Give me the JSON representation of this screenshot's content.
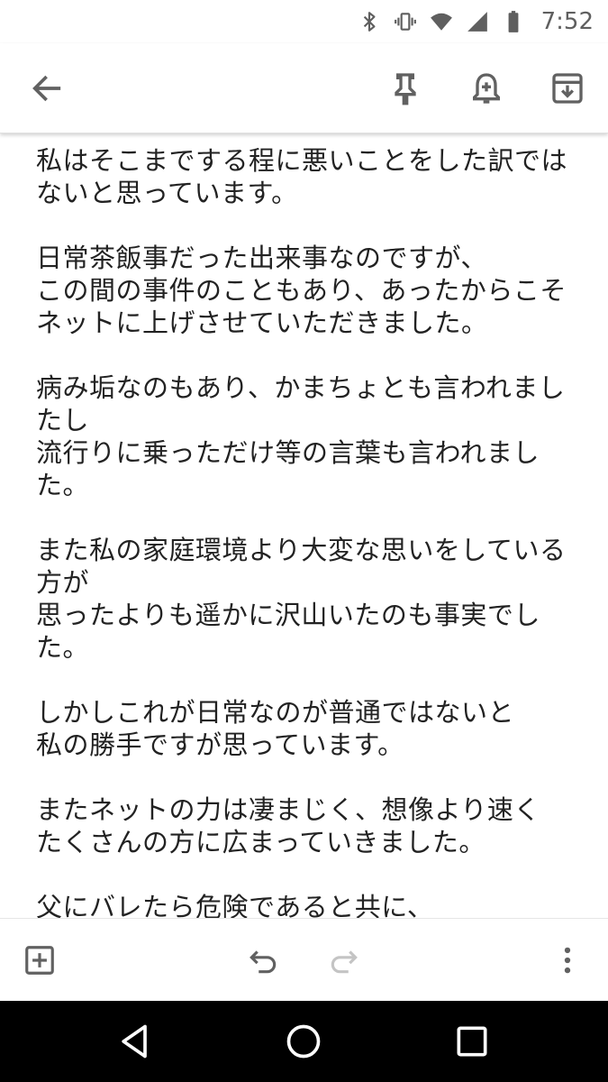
{
  "status_bar": {
    "time": "7:52",
    "icons": [
      "bluetooth-icon",
      "vibrate-icon",
      "wifi-icon",
      "cell-signal-icon",
      "battery-icon"
    ]
  },
  "toolbar": {
    "back_icon": "arrow-back-icon",
    "pin_icon": "pin-icon",
    "reminder_icon": "add-alert-icon",
    "archive_icon": "archive-icon"
  },
  "note": {
    "lines": [
      "私はそこまでする程に悪いことをした訳では",
      "ないと思っています。",
      "",
      "日常茶飯事だった出来事なのですが、",
      "この間の事件のこともあり、あったからこそ",
      "ネットに上げさせていただきました。",
      "",
      "病み垢なのもあり、かまちょとも言われまし",
      "たし",
      "流行りに乗っただけ等の言葉も言われまし",
      "た。",
      "",
      "また私の家庭環境より大変な思いをしている",
      "方が",
      "思ったよりも遥かに沢山いたのも事実でし",
      "た。",
      "",
      "しかしこれが日常なのが普通ではないと",
      "私の勝手ですが思っています。",
      "",
      "またネットの力は凄まじく、想像より速く",
      "たくさんの方に広まっていきました。",
      "",
      "父にバレたら危険であると共に、"
    ]
  },
  "note_toolbar": {
    "add_icon": "add-box-icon",
    "undo_icon": "undo-icon",
    "redo_icon": "redo-icon",
    "more_icon": "more-vert-icon"
  },
  "nav_bar": {
    "back_icon": "nav-back-icon",
    "home_icon": "nav-home-icon",
    "recents_icon": "nav-recents-icon"
  },
  "colors": {
    "icon_gray": "#616161",
    "text": "#222222",
    "nav_bar_bg": "#000000"
  }
}
